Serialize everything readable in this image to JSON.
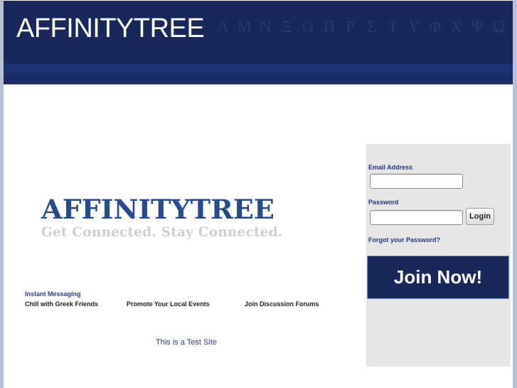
{
  "header": {
    "title": "AFFINITYTREE",
    "greek_letters": [
      "Λ",
      "Μ",
      "Ν",
      "Ξ",
      "Ο",
      "Π",
      "Ρ",
      "Σ",
      "Τ",
      "Υ",
      "Φ",
      "Χ",
      "Ψ",
      "Ω"
    ]
  },
  "logo": {
    "name": "AFFINITYTREE",
    "tagline": "Get Connected. Stay Connected."
  },
  "features": {
    "heading": "Instant Messaging",
    "items": [
      "Chill with Greek Friends",
      "Promote Your Local Events",
      "Join Discussion Forums"
    ]
  },
  "footer_note": "This is a Test Site",
  "login": {
    "email_label": "Email Address",
    "email_value": "",
    "password_label": "Password",
    "password_value": "",
    "login_button": "Login",
    "forgot_link": "Forgot your Password?",
    "join_button": "Join Now!"
  },
  "colors": {
    "header_bg": "#18285a",
    "brand_blue": "#284a92",
    "link_blue": "#253683",
    "panel_bg": "#e6e6e6"
  }
}
